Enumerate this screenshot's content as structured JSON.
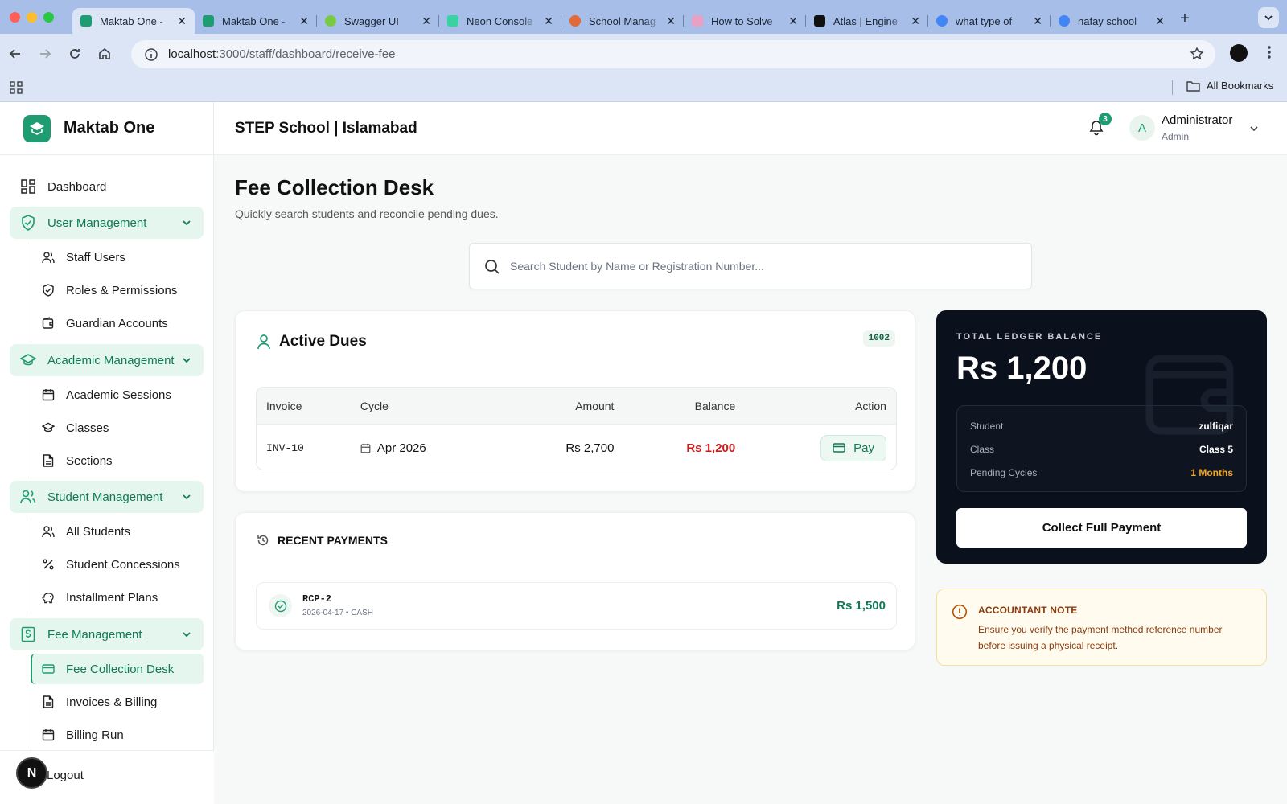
{
  "browser": {
    "tabs": [
      {
        "title": "Maktab One - ",
        "favicon_color": "#1f9d72",
        "active": true
      },
      {
        "title": "Maktab One - ",
        "favicon_color": "#1f9d72",
        "active": false
      },
      {
        "title": "Swagger UI",
        "favicon_color": "#7ac943",
        "active": false
      },
      {
        "title": "Neon Console",
        "favicon_color": "#39d3a1",
        "active": false
      },
      {
        "title": "School Manag",
        "favicon_color": "#e06b3a",
        "active": false
      },
      {
        "title": "How to Solve",
        "favicon_color": "#e9a0c5",
        "active": false
      },
      {
        "title": "Atlas | Engine",
        "favicon_color": "#111111",
        "active": false
      },
      {
        "title": "what type of",
        "favicon_color": "#4285f4",
        "active": false
      },
      {
        "title": "nafay school",
        "favicon_color": "#4285f4",
        "active": false
      }
    ],
    "url_host": "localhost",
    "url_path": ":3000/staff/dashboard/receive-fee",
    "all_bookmarks": "All Bookmarks"
  },
  "brand": {
    "name": "Maktab One"
  },
  "header": {
    "school": "STEP School | Islamabad",
    "notification_count": "3",
    "avatar_initial": "A",
    "user_name": "Administrator",
    "user_role": "Admin"
  },
  "sidebar": {
    "dashboard": "Dashboard",
    "groups": [
      {
        "label": "User Management",
        "items": [
          "Staff Users",
          "Roles & Permissions",
          "Guardian Accounts"
        ]
      },
      {
        "label": "Academic Management",
        "items": [
          "Academic Sessions",
          "Classes",
          "Sections"
        ]
      },
      {
        "label": "Student Management",
        "items": [
          "All Students",
          "Student Concessions",
          "Installment Plans"
        ]
      },
      {
        "label": "Fee Management",
        "items": [
          "Fee Collection Desk",
          "Invoices & Billing",
          "Billing Run"
        ]
      }
    ],
    "active_item": "Fee Collection Desk",
    "logout": "Logout",
    "dev_badge": "N"
  },
  "page": {
    "title": "Fee Collection Desk",
    "subtitle": "Quickly search students and reconcile pending dues.",
    "search_placeholder": "Search Student by Name or Registration Number..."
  },
  "dues": {
    "title": "Active Dues",
    "registration": "1002",
    "columns": [
      "Invoice",
      "Cycle",
      "Amount",
      "Balance",
      "Action"
    ],
    "rows": [
      {
        "invoice": "INV-10",
        "cycle": "Apr 2026",
        "amount": "Rs 2,700",
        "balance": "Rs 1,200",
        "action": "Pay"
      }
    ]
  },
  "recent": {
    "title": "RECENT PAYMENTS",
    "payments": [
      {
        "id": "RCP-2",
        "meta": "2026-04-17 • CASH",
        "amount": "Rs 1,500"
      }
    ]
  },
  "ledger": {
    "label": "TOTAL LEDGER BALANCE",
    "amount": "Rs 1,200",
    "student_label": "Student",
    "student": "zulfiqar",
    "class_label": "Class",
    "class": "Class 5",
    "cycles_label": "Pending Cycles",
    "cycles": "1 Months",
    "collect": "Collect Full Payment"
  },
  "note": {
    "title": "ACCOUNTANT NOTE",
    "text": "Ensure you verify the payment method reference number before issuing a physical receipt."
  },
  "colors": {
    "accent": "#1f9d72",
    "accent_light": "#e5f6ee",
    "danger": "#c81e1e",
    "amber": "#f5a524",
    "ledger_bg": "#0b111c"
  }
}
